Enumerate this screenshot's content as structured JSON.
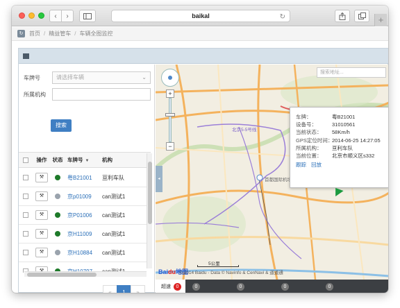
{
  "browser": {
    "address": "baikal"
  },
  "breadcrumb": {
    "items": [
      "首页",
      "精益管车",
      "车辆全图监控"
    ]
  },
  "filters": {
    "plate_label": "车牌号",
    "plate_placeholder": "请选择车辆",
    "org_label": "所属机构",
    "search_label": "搜索"
  },
  "table": {
    "headers": [
      "操作",
      "状态",
      "车牌号",
      "机构"
    ],
    "rows": [
      {
        "plate": "粤B21001",
        "org": "亘利车队",
        "status_color": "#1e7a2a"
      },
      {
        "plate": "京p01009",
        "org": "can测试1",
        "status_color": "#9aa3ad"
      },
      {
        "plate": "京P01006",
        "org": "can测试1",
        "status_color": "#1e7a2a"
      },
      {
        "plate": "京H11009",
        "org": "can测试1",
        "status_color": "#1e7a2a"
      },
      {
        "plate": "京H10884",
        "org": "can测试1",
        "status_color": "#9aa3ad"
      },
      {
        "plate": "京H10797",
        "org": "can测试1",
        "status_color": "#1e7a2a"
      }
    ]
  },
  "pager": {
    "prev": "«",
    "current": "1",
    "next": "»"
  },
  "map": {
    "search_placeholder": "搜索地址...",
    "info": [
      {
        "k": "车牌：",
        "v": "粤B21001"
      },
      {
        "k": "设备号：",
        "v": "31010561"
      },
      {
        "k": "当前状态：",
        "v": "58Km/h"
      },
      {
        "k": "GPS定位时间：",
        "v": "2014-06-25 14:27:05"
      },
      {
        "k": "所属机构：",
        "v": "亘利车队"
      },
      {
        "k": "当前位置：",
        "v": "北京市顺义区s332"
      }
    ],
    "link_track": "跟踪",
    "link_replay": "回放",
    "labels": {
      "airport": "首都国际机场",
      "highway": "北京5-5号线",
      "scale": "5公里",
      "baidu": "Bai",
      "baidu2": "du",
      "baidu3": "地图",
      "copyright": "© 2014 Baidu - Data © Navinfo & CenNavi & 道道通"
    }
  },
  "alarm_bar": {
    "tabs": [
      {
        "label": "超速",
        "count": "0",
        "active": true
      },
      {
        "label": "",
        "count": "0",
        "active": false
      },
      {
        "label": "",
        "count": "0",
        "active": false
      },
      {
        "label": "",
        "count": "0",
        "active": false
      },
      {
        "label": "",
        "count": "0",
        "active": false
      }
    ]
  },
  "colors": {
    "accent": "#3f7fc3",
    "online": "#1e7a2a",
    "offline": "#9aa3ad",
    "alarm": "#d22222"
  }
}
